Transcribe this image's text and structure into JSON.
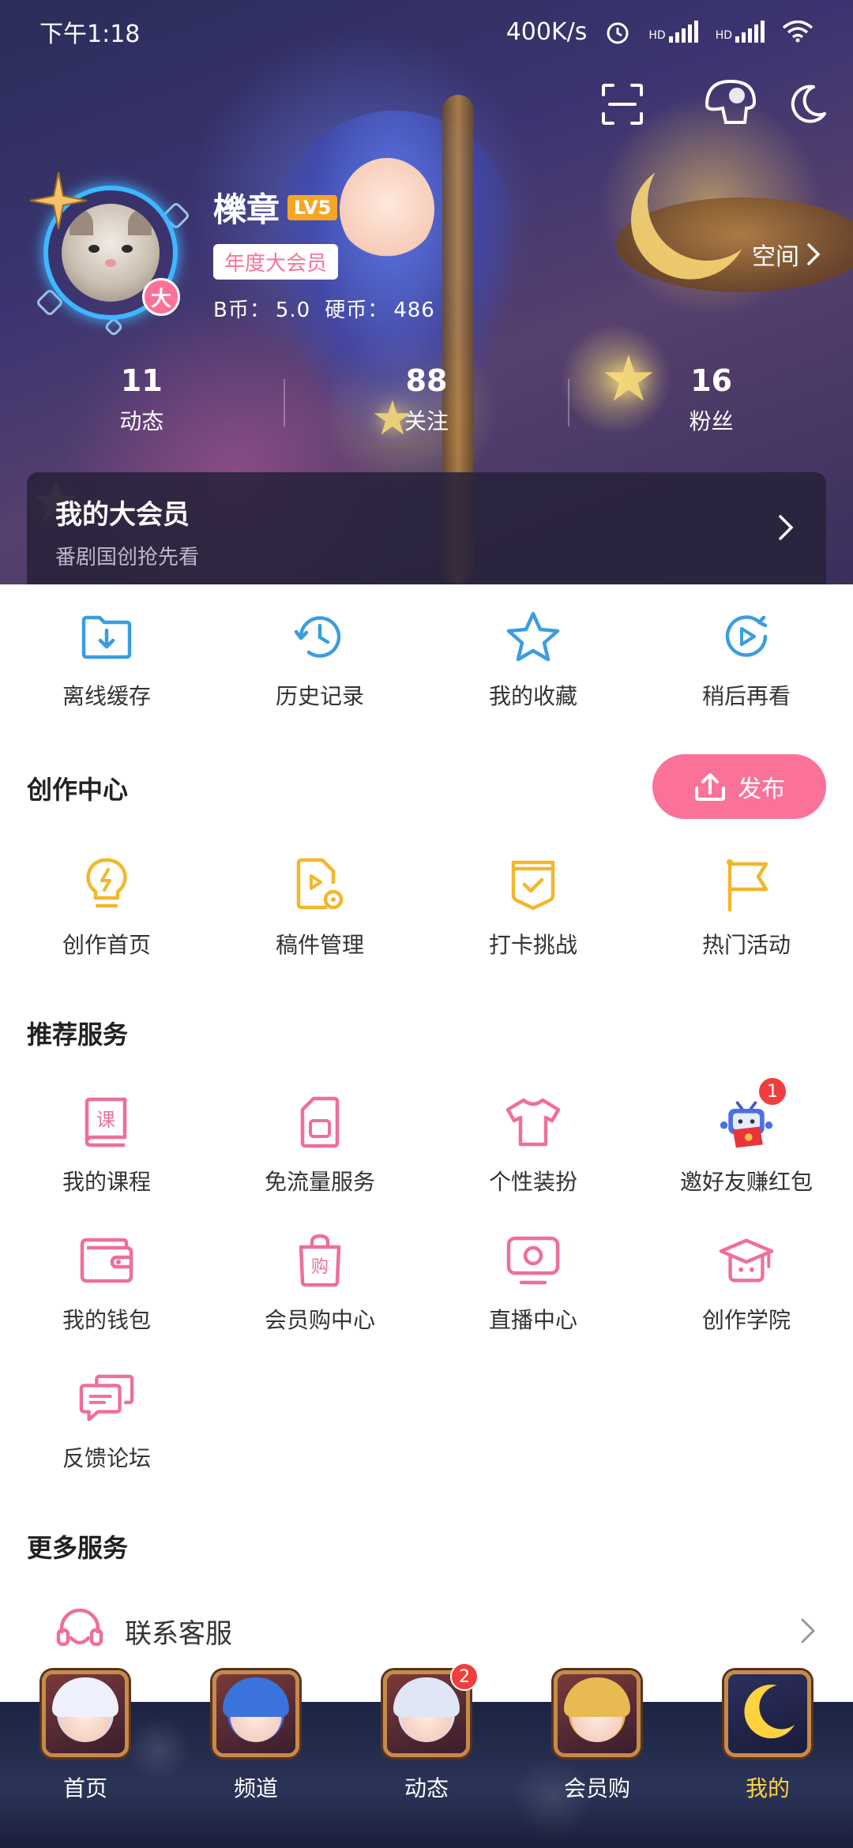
{
  "status_bar": {
    "time": "下午1:18",
    "net_speed": "400K/s",
    "hd1": "HD",
    "hd2": "HD"
  },
  "profile": {
    "username": "櫟章",
    "level": "LV5",
    "vip_tag": "年度大会员",
    "b_coin_label": "B币：",
    "b_coin_value": "5.0",
    "coin_label": "硬币：",
    "coin_value": "486",
    "avatar_badge": "大",
    "space_link": "空间"
  },
  "stats": [
    {
      "num": "11",
      "label": "动态"
    },
    {
      "num": "88",
      "label": "关注"
    },
    {
      "num": "16",
      "label": "粉丝"
    }
  ],
  "vip_card": {
    "title": "我的大会员",
    "subtitle": "番剧国创抢先看"
  },
  "quick_actions": [
    {
      "label": "离线缓存",
      "icon": "download-folder-icon"
    },
    {
      "label": "历史记录",
      "icon": "history-clock-icon"
    },
    {
      "label": "我的收藏",
      "icon": "star-icon"
    },
    {
      "label": "稍后再看",
      "icon": "watch-later-icon"
    }
  ],
  "creation": {
    "title": "创作中心",
    "publish_label": "发布",
    "items": [
      {
        "label": "创作首页",
        "icon": "lightbulb-icon"
      },
      {
        "label": "稿件管理",
        "icon": "manuscript-icon"
      },
      {
        "label": "打卡挑战",
        "icon": "checkin-icon"
      },
      {
        "label": "热门活动",
        "icon": "flag-icon"
      }
    ]
  },
  "recommend": {
    "title": "推荐服务",
    "items": [
      {
        "label": "我的课程",
        "icon": "course-icon",
        "glyph": "课"
      },
      {
        "label": "免流量服务",
        "icon": "sim-card-icon"
      },
      {
        "label": "个性装扮",
        "icon": "tshirt-icon"
      },
      {
        "label": "邀好友赚红包",
        "icon": "tv-mascot-icon",
        "badge": "1"
      },
      {
        "label": "我的钱包",
        "icon": "wallet-icon"
      },
      {
        "label": "会员购中心",
        "icon": "shopping-bag-icon",
        "glyph": "购"
      },
      {
        "label": "直播中心",
        "icon": "live-tv-icon"
      },
      {
        "label": "创作学院",
        "icon": "graduation-cap-icon"
      },
      {
        "label": "反馈论坛",
        "icon": "chat-bubbles-icon"
      }
    ]
  },
  "more": {
    "title": "更多服务",
    "items": [
      {
        "label": "联系客服",
        "icon": "headset-icon"
      }
    ]
  },
  "bottom_nav": [
    {
      "label": "首页",
      "active": false
    },
    {
      "label": "频道",
      "active": false
    },
    {
      "label": "动态",
      "active": false,
      "badge": "2"
    },
    {
      "label": "会员购",
      "active": false
    },
    {
      "label": "我的",
      "active": true
    }
  ],
  "colors": {
    "accent_pink": "#fb7299",
    "icon_blue": "#3a9ddf",
    "icon_gold": "#f2b72b",
    "icon_pink": "#ef6f99",
    "active_nav": "#ffd23f"
  }
}
